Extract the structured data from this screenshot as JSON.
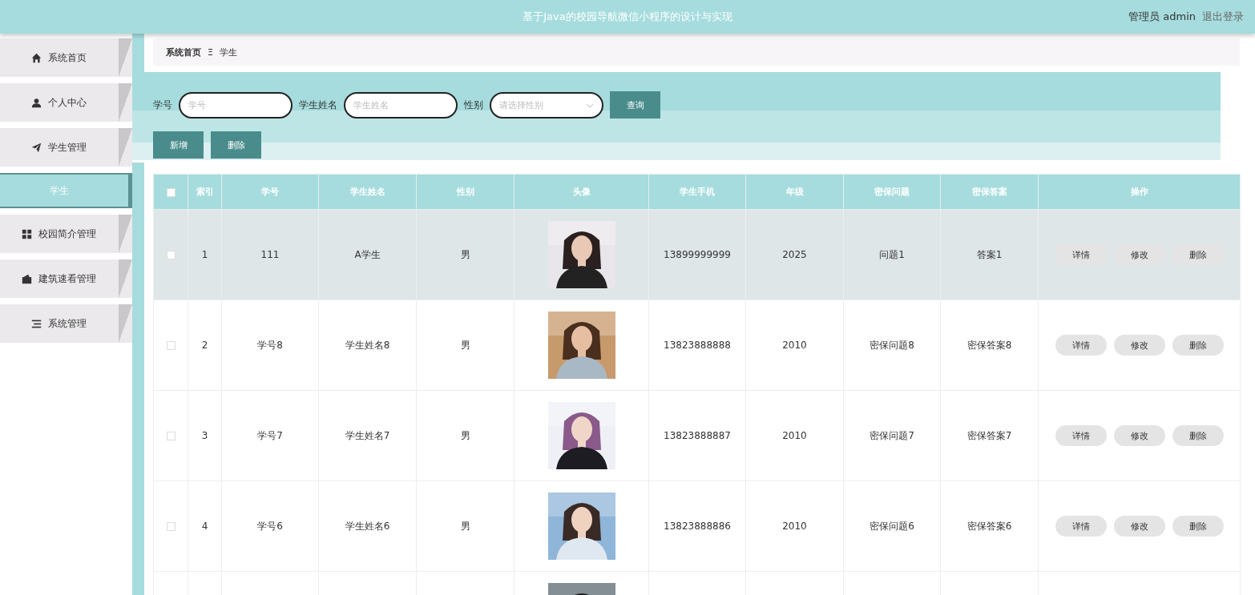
{
  "header": {
    "title": "基于Java的校园导航微信小程序的设计与实现",
    "user": "管理员 admin",
    "logout": "退出登录"
  },
  "sidebar": {
    "items": [
      {
        "label": "系统首页",
        "selected": false
      },
      {
        "label": "个人中心",
        "selected": false
      },
      {
        "label": "学生管理",
        "selected": false,
        "children": [
          {
            "label": "学生",
            "selected": true
          }
        ]
      },
      {
        "label": "校园简介管理",
        "selected": false
      },
      {
        "label": "建筑速看管理",
        "selected": false
      },
      {
        "label": "系统管理",
        "selected": false
      }
    ]
  },
  "breadcrumb": {
    "home": "系统首页",
    "separator": "Ξ",
    "current": "学生"
  },
  "search": {
    "fields": [
      {
        "kind": "input",
        "label": "学号",
        "placeholder": "学号"
      },
      {
        "kind": "input",
        "label": "学生姓名",
        "placeholder": "学生姓名"
      },
      {
        "kind": "select",
        "label": "性别",
        "placeholder": "请选择性别"
      }
    ],
    "button": "查询"
  },
  "actions": [
    "新增",
    "删除"
  ],
  "table": {
    "select_all_checked": false,
    "columns": [
      "索引",
      "学号",
      "学生姓名",
      "性别",
      "头像",
      "学生手机",
      "年级",
      "密保问题",
      "密保答案",
      "操作"
    ],
    "rows": [
      {
        "selected": true,
        "checked": false,
        "index": "1",
        "student_no": "111",
        "name": "A学生",
        "gender": "男",
        "phone": "13899999999",
        "grade": "2025",
        "question": "问题1",
        "answer": "答案1",
        "buttons": [
          "详情",
          "修改",
          "删除"
        ]
      },
      {
        "selected": false,
        "checked": false,
        "index": "2",
        "student_no": "学号8",
        "name": "学生姓名8",
        "gender": "男",
        "phone": "13823888888",
        "grade": "2010",
        "question": "密保问题8",
        "answer": "密保答案8",
        "buttons": [
          "详情",
          "修改",
          "删除"
        ]
      },
      {
        "selected": false,
        "checked": false,
        "index": "3",
        "student_no": "学号7",
        "name": "学生姓名7",
        "gender": "男",
        "phone": "13823888887",
        "grade": "2010",
        "question": "密保问题7",
        "answer": "密保答案7",
        "buttons": [
          "详情",
          "修改",
          "删除"
        ]
      },
      {
        "selected": false,
        "checked": false,
        "index": "4",
        "student_no": "学号6",
        "name": "学生姓名6",
        "gender": "男",
        "phone": "13823888886",
        "grade": "2010",
        "question": "密保问题6",
        "answer": "密保答案6",
        "buttons": [
          "详情",
          "修改",
          "删除"
        ]
      },
      {
        "selected": false
      }
    ]
  }
}
